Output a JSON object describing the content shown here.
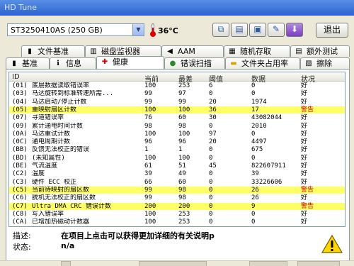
{
  "window": {
    "title": "HD Tune"
  },
  "toolbar": {
    "drive": "ST3250410AS  (250 GB)",
    "temperature": "36°C",
    "exit_label": "退出"
  },
  "tabs": [
    {
      "label": "文件基准",
      "icon": "file-benchmark-icon"
    },
    {
      "label": "磁盘监视器",
      "icon": "disk-monitor-icon"
    },
    {
      "label": "AAM",
      "icon": "speaker-icon"
    },
    {
      "label": "随机存取",
      "icon": "random-access-icon"
    },
    {
      "label": "额外测试",
      "icon": "extra-tests-icon"
    },
    {
      "label": "基准",
      "icon": "benchmark-icon"
    },
    {
      "label": "信息",
      "icon": "info-icon"
    },
    {
      "label": "健康",
      "icon": "health-cross-icon"
    },
    {
      "label": "错误扫描",
      "icon": "error-scan-icon"
    },
    {
      "label": "文件夹占用率",
      "icon": "folder-usage-icon"
    },
    {
      "label": "擦除",
      "icon": "erase-icon"
    }
  ],
  "active_tab": "健康",
  "table": {
    "headers": [
      "ID",
      "当前",
      "最差",
      "阈值",
      "数据",
      "状况"
    ],
    "rows": [
      {
        "id": "(01)",
        "name": "底层数据读取错误率",
        "cur": "100",
        "worst": "253",
        "thr": "6",
        "data": "0",
        "status": "好",
        "warn": false
      },
      {
        "id": "(03)",
        "name": "马达旋转到标准转速所需...",
        "cur": "99",
        "worst": "97",
        "thr": "0",
        "data": "0",
        "status": "好",
        "warn": false
      },
      {
        "id": "(04)",
        "name": "马达启动/停止计数",
        "cur": "99",
        "worst": "99",
        "thr": "20",
        "data": "1974",
        "status": "好",
        "warn": false
      },
      {
        "id": "(05)",
        "name": "重映射扇区计数",
        "cur": "100",
        "worst": "100",
        "thr": "36",
        "data": "17",
        "status": "警告",
        "warn": true
      },
      {
        "id": "(07)",
        "name": "寻道错误率",
        "cur": "76",
        "worst": "60",
        "thr": "30",
        "data": "43082044",
        "status": "好",
        "warn": false
      },
      {
        "id": "(09)",
        "name": "累计通电时间计数",
        "cur": "98",
        "worst": "98",
        "thr": "0",
        "data": "2010",
        "status": "好",
        "warn": false
      },
      {
        "id": "(0A)",
        "name": "马达重试计数",
        "cur": "100",
        "worst": "100",
        "thr": "97",
        "data": "0",
        "status": "好",
        "warn": false
      },
      {
        "id": "(0C)",
        "name": "通电周期计数",
        "cur": "96",
        "worst": "96",
        "thr": "20",
        "data": "4497",
        "status": "好",
        "warn": false
      },
      {
        "id": "(BB)",
        "name": "反馈无法校正的错误",
        "cur": "1",
        "worst": "1",
        "thr": "0",
        "data": "675",
        "status": "好",
        "warn": false
      },
      {
        "id": "(BD)",
        "name": "(未知属性)",
        "cur": "100",
        "worst": "100",
        "thr": "0",
        "data": "0",
        "status": "好",
        "warn": false
      },
      {
        "id": "(BE)",
        "name": "气流温度",
        "cur": "61",
        "worst": "51",
        "thr": "45",
        "data": "822607911",
        "status": "好",
        "warn": false
      },
      {
        "id": "(C2)",
        "name": "温度",
        "cur": "39",
        "worst": "49",
        "thr": "0",
        "data": "39",
        "status": "好",
        "warn": false
      },
      {
        "id": "(C3)",
        "name": "硬件 ECC 校正",
        "cur": "66",
        "worst": "60",
        "thr": "0",
        "data": "33226606",
        "status": "好",
        "warn": false
      },
      {
        "id": "(C5)",
        "name": "当前待映射的扇区数",
        "cur": "99",
        "worst": "98",
        "thr": "0",
        "data": "26",
        "status": "警告",
        "warn": true
      },
      {
        "id": "(C6)",
        "name": "脱机无法校正的扇区数",
        "cur": "99",
        "worst": "98",
        "thr": "0",
        "data": "26",
        "status": "好",
        "warn": false
      },
      {
        "id": "(C7)",
        "name": "Ultra DMA CRC 错误计数",
        "cur": "200",
        "worst": "200",
        "thr": "0",
        "data": "9",
        "status": "警告",
        "warn": true
      },
      {
        "id": "(C8)",
        "name": "写入错误率",
        "cur": "100",
        "worst": "253",
        "thr": "0",
        "data": "0",
        "status": "好",
        "warn": false
      },
      {
        "id": "(CA)",
        "name": "已增加热磁动计数器",
        "cur": "100",
        "worst": "253",
        "thr": "0",
        "data": "0",
        "status": "好",
        "warn": false
      }
    ]
  },
  "info": {
    "desc_label": "描述:",
    "desc_value": "在项目上点击可以获得更加详细的有关说明p",
    "status_label": "状态:",
    "status_value": "n/a"
  },
  "colors": {
    "warn_row": "#ffff66",
    "warn_status": "#cc0000"
  }
}
